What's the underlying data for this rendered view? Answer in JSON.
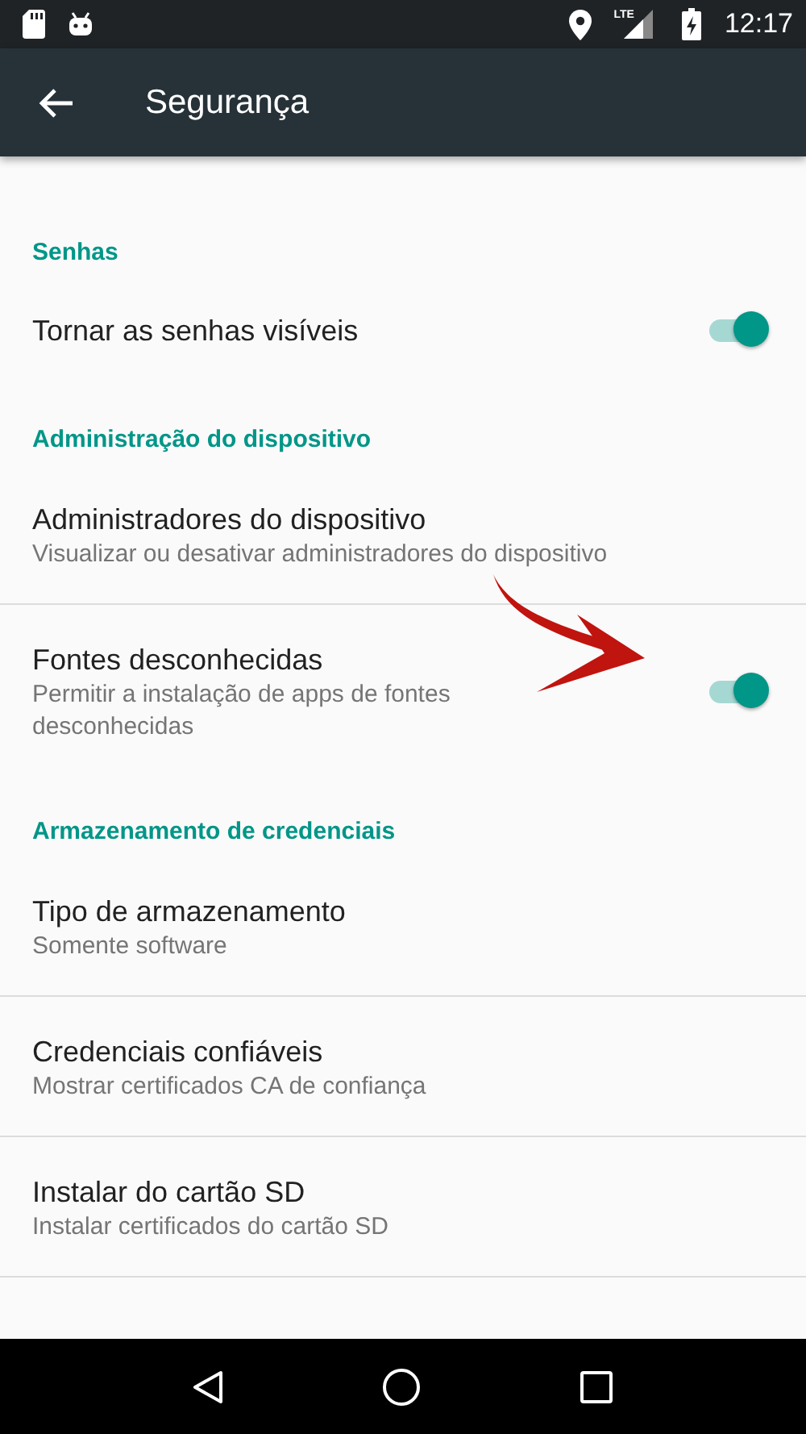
{
  "status_bar": {
    "network": "LTE",
    "time": "12:17"
  },
  "app_bar": {
    "title": "Segurança"
  },
  "items": [
    {
      "kind": "header",
      "title": "Senhas"
    },
    {
      "kind": "switch",
      "title": "Tornar as senhas visíveis",
      "on": true,
      "divider_after": false
    },
    {
      "kind": "header",
      "title": "Administração do dispositivo"
    },
    {
      "kind": "setting",
      "title": "Administradores do dispositivo",
      "summary": "Visualizar ou desativar administradores do dispositivo",
      "divider_after": true
    },
    {
      "kind": "switch",
      "title": "Fontes desconhecidas",
      "summary": "Permitir a instalação de apps de fontes desconhecidas",
      "on": true,
      "divider_after": false
    },
    {
      "kind": "header",
      "title": "Armazenamento de credenciais"
    },
    {
      "kind": "setting",
      "title": "Tipo de armazenamento",
      "summary": "Somente software",
      "divider_after": true
    },
    {
      "kind": "setting",
      "title": "Credenciais confiáveis",
      "summary": "Mostrar certificados CA de confiança",
      "divider_after": true
    },
    {
      "kind": "setting",
      "title": "Instalar do cartão SD",
      "summary": "Instalar certificados do cartão SD",
      "divider_after": true
    }
  ]
}
